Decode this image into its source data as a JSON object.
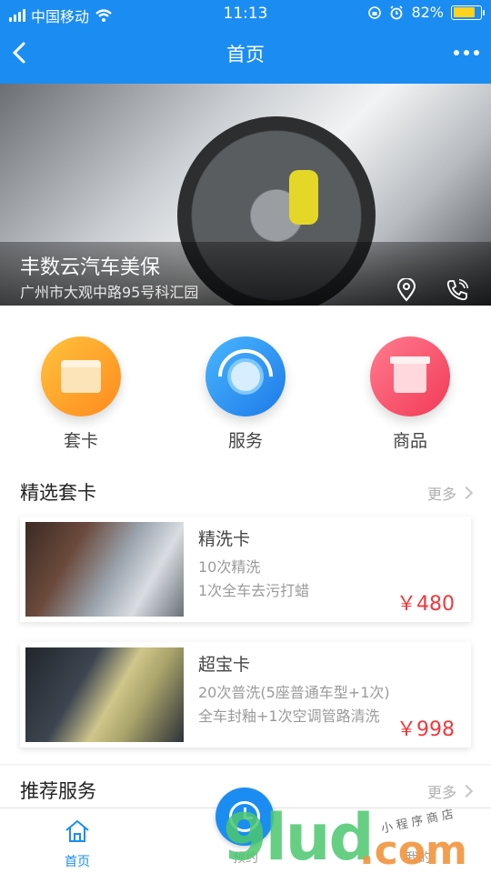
{
  "status_bar": {
    "carrier": "中国移动",
    "time": "11:13",
    "battery": "82%",
    "battery_level": 0.82
  },
  "nav": {
    "title": "首页"
  },
  "banner": {
    "shop_name": "丰数云汽车美保",
    "address": "广州市大观中路95号科汇园"
  },
  "categories": [
    {
      "label": "套卡",
      "icon": "card-icon"
    },
    {
      "label": "服务",
      "icon": "service-icon"
    },
    {
      "label": "商品",
      "icon": "product-icon"
    }
  ],
  "featured": {
    "title": "精选套卡",
    "more": "更多",
    "cards": [
      {
        "name": "精洗卡",
        "desc1": "10次精洗",
        "desc2": "1次全车去污打蜡",
        "price": "￥480"
      },
      {
        "name": "超宝卡",
        "desc1": "20次普洗(5座普通车型+1次)",
        "desc2": "全车封釉+1次空调管路清洗",
        "price": "￥998"
      }
    ]
  },
  "recommended": {
    "title": "推荐服务",
    "more": "更多"
  },
  "tabbar": {
    "home": "首页",
    "booking": "预约",
    "mine": "我的"
  },
  "watermark": {
    "brand": "9lud",
    "suffix": ".com",
    "tagline": "小程序商店"
  },
  "colors": {
    "primary": "#1b8df2",
    "price": "#f2383d"
  }
}
